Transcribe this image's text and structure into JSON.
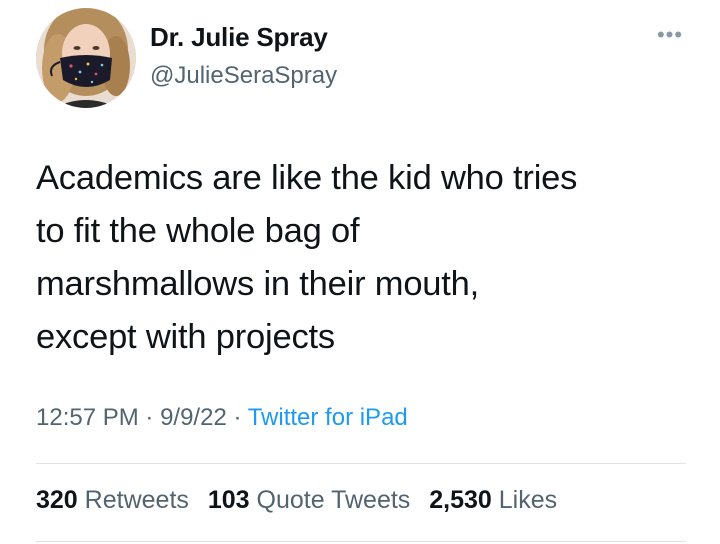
{
  "author": {
    "display_name": "Dr. Julie Spray",
    "handle": "@JulieSeraSpray"
  },
  "more_icon": "more-options-icon",
  "tweet": {
    "lines": [
      "Academics are like the kid who tries",
      "to fit the whole bag of",
      "marshmallows in their mouth,",
      "except with projects"
    ]
  },
  "meta": {
    "time": "12:57 PM",
    "separator": " · ",
    "date": "9/9/22",
    "source": "Twitter for iPad"
  },
  "stats": {
    "retweets_count": "320",
    "retweets_label": "Retweets",
    "quotes_count": "103",
    "quotes_label": "Quote Tweets",
    "likes_count": "2,530",
    "likes_label": "Likes"
  },
  "colors": {
    "accent": "#1d9bf0",
    "secondary_text": "#536471",
    "primary_text": "#0f1419"
  }
}
